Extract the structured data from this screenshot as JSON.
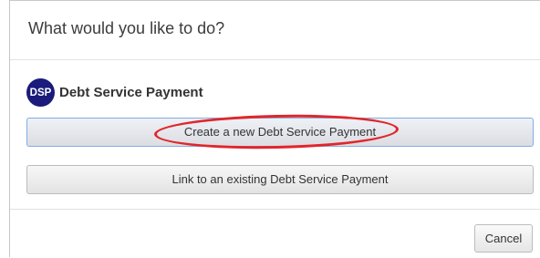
{
  "dialog": {
    "title": "What would you like to do?"
  },
  "object": {
    "icon_text": "DSP",
    "icon_color": "#1a1b7a",
    "name": "Debt Service Payment"
  },
  "actions": {
    "create_label": "Create a new Debt Service Payment",
    "link_label": "Link to an existing Debt Service Payment"
  },
  "footer": {
    "cancel_label": "Cancel"
  },
  "annotation": {
    "highlight_color": "#e0262b"
  }
}
